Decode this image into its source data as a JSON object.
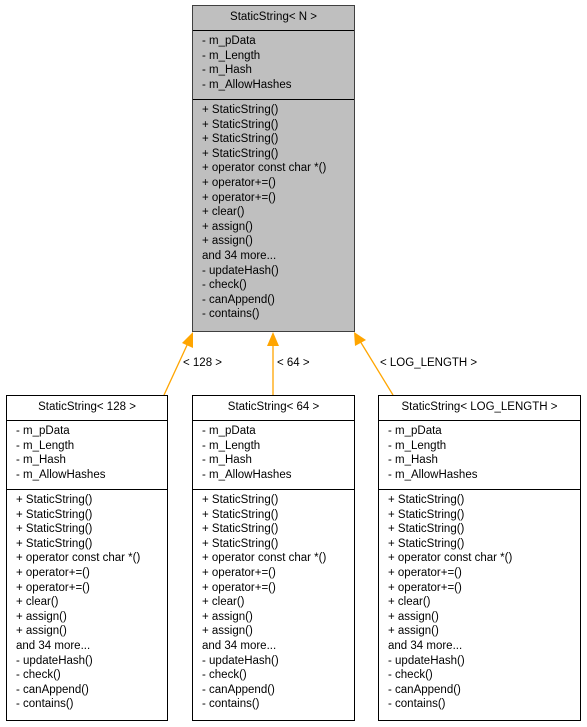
{
  "base_class": {
    "name": "StaticString< N >",
    "attributes": [
      "- m_pData",
      "- m_Length",
      "- m_Hash",
      "- m_AllowHashes"
    ],
    "methods": [
      "+ StaticString()",
      "+ StaticString()",
      "+ StaticString()",
      "+ StaticString()",
      "+ operator const char *()",
      "+ operator+=()",
      "+ operator+=()",
      "+ clear()",
      "+ assign()",
      "+ assign()",
      "and 34 more...",
      "- updateHash()",
      "- check()",
      "- canAppend()",
      "- contains()"
    ]
  },
  "derived_classes": [
    {
      "name": "StaticString< 128 >",
      "edge_label": "< 128 >",
      "attributes": [
        "- m_pData",
        "- m_Length",
        "- m_Hash",
        "- m_AllowHashes"
      ],
      "methods": [
        "+ StaticString()",
        "+ StaticString()",
        "+ StaticString()",
        "+ StaticString()",
        "+ operator const char *()",
        "+ operator+=()",
        "+ operator+=()",
        "+ clear()",
        "+ assign()",
        "+ assign()",
        "and 34 more...",
        "- updateHash()",
        "- check()",
        "- canAppend()",
        "- contains()"
      ]
    },
    {
      "name": "StaticString< 64 >",
      "edge_label": "< 64 >",
      "attributes": [
        "- m_pData",
        "- m_Length",
        "- m_Hash",
        "- m_AllowHashes"
      ],
      "methods": [
        "+ StaticString()",
        "+ StaticString()",
        "+ StaticString()",
        "+ StaticString()",
        "+ operator const char *()",
        "+ operator+=()",
        "+ operator+=()",
        "+ clear()",
        "+ assign()",
        "+ assign()",
        "and 34 more...",
        "- updateHash()",
        "- check()",
        "- canAppend()",
        "- contains()"
      ]
    },
    {
      "name": "StaticString< LOG_LENGTH >",
      "edge_label": "< LOG_LENGTH >",
      "attributes": [
        "- m_pData",
        "- m_Length",
        "- m_Hash",
        "- m_AllowHashes"
      ],
      "methods": [
        "+ StaticString()",
        "+ StaticString()",
        "+ StaticString()",
        "+ StaticString()",
        "+ operator const char *()",
        "+ operator+=()",
        "+ operator+=()",
        "+ clear()",
        "+ assign()",
        "+ assign()",
        "and 34 more...",
        "- updateHash()",
        "- check()",
        "- canAppend()",
        "- contains()"
      ]
    }
  ],
  "colors": {
    "edge": "#ffa500",
    "base_fill": "#bfbfbf",
    "derived_fill": "#ffffff"
  }
}
